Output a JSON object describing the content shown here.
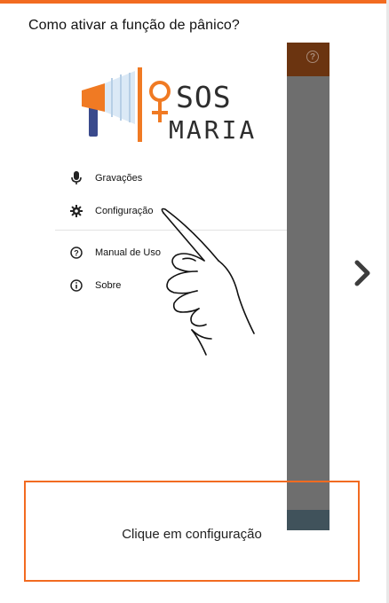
{
  "page": {
    "title": "Como ativar a função de pânico?"
  },
  "app": {
    "logo_line1": "SOS",
    "logo_line2": "MARIA",
    "brand_color": "#f26b21",
    "help_icon": "help-circle-icon"
  },
  "menu": {
    "items": [
      {
        "label": "Gravações",
        "icon": "microphone-icon"
      },
      {
        "label": "Configuração",
        "icon": "gear-icon"
      },
      {
        "label": "Manual de Uso",
        "icon": "help-circle-icon"
      },
      {
        "label": "Sobre",
        "icon": "info-icon"
      }
    ]
  },
  "navigation": {
    "next_icon": "chevron-right-icon"
  },
  "instruction": {
    "text": "Clique em configuração",
    "border_color": "#f26b21"
  }
}
